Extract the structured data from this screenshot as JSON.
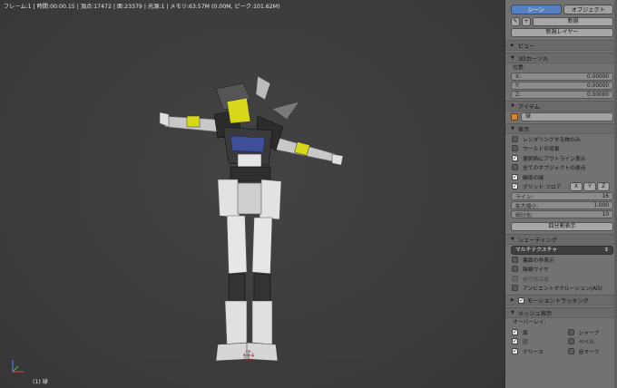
{
  "viewport": {
    "header_text": "フレーム:1 | 時間:00:00.15 | 頂点:17472 | 面:23379 | 光源:1 | メモリ:63.57M (0.00M, ピーク:101.62M)",
    "footer_text": "(1) 球"
  },
  "panel": {
    "tabs": [
      "シーン",
      "オブジェクト"
    ],
    "new_label": "新規",
    "new_layer_label": "新規レイヤー",
    "sections": {
      "view": "ビュー",
      "cursor3d": "3Dカーソル",
      "item": "アイテム",
      "display": "表示",
      "shading": "シェーディング",
      "motion_tracking": "モーショントラッキング",
      "mesh_display": "メッシュ表示"
    },
    "cursor3d": {
      "position_label": "位置:",
      "x_label": "X:",
      "x": "0.00000",
      "y_label": "Y:",
      "y": "0.00000",
      "z_label": "Z:",
      "z": "0.00000"
    },
    "item": {
      "name": "球"
    },
    "display": {
      "only_render": "レンダリングする物のみ",
      "world_background": "ワールドの背景",
      "outline_selected": "選択時にアウトライン表示",
      "all_object_origins": "全てのオブジェクトの原点",
      "relationship_lines": "関係の線",
      "grid_floor": "グリッド フロア",
      "axis_x": "X",
      "axis_y": "Y",
      "axis_z": "Z",
      "lines_label": "ライン:",
      "lines": "16",
      "scale_label": "拡大縮小:",
      "scale": "1.000",
      "subdivisions_label": "細分化:",
      "subdivisions": "10",
      "quad_view": "四分割表示"
    },
    "shading": {
      "mode": "マルチテクスチャ",
      "backface_culling": "裏面の非表示",
      "hidden_wire": "陰線ワイヤ",
      "depth_of_field": "被写界深度",
      "ambient_occlusion": "アンビエントオクルージョン(AO)"
    },
    "mesh_display": {
      "overlay_label": "オーバーレイ:",
      "faces": "面",
      "sharp": "シャープ",
      "edges": "辺",
      "bevel": "ベベル",
      "crease": "クリース",
      "seams": "@マーク"
    }
  }
}
